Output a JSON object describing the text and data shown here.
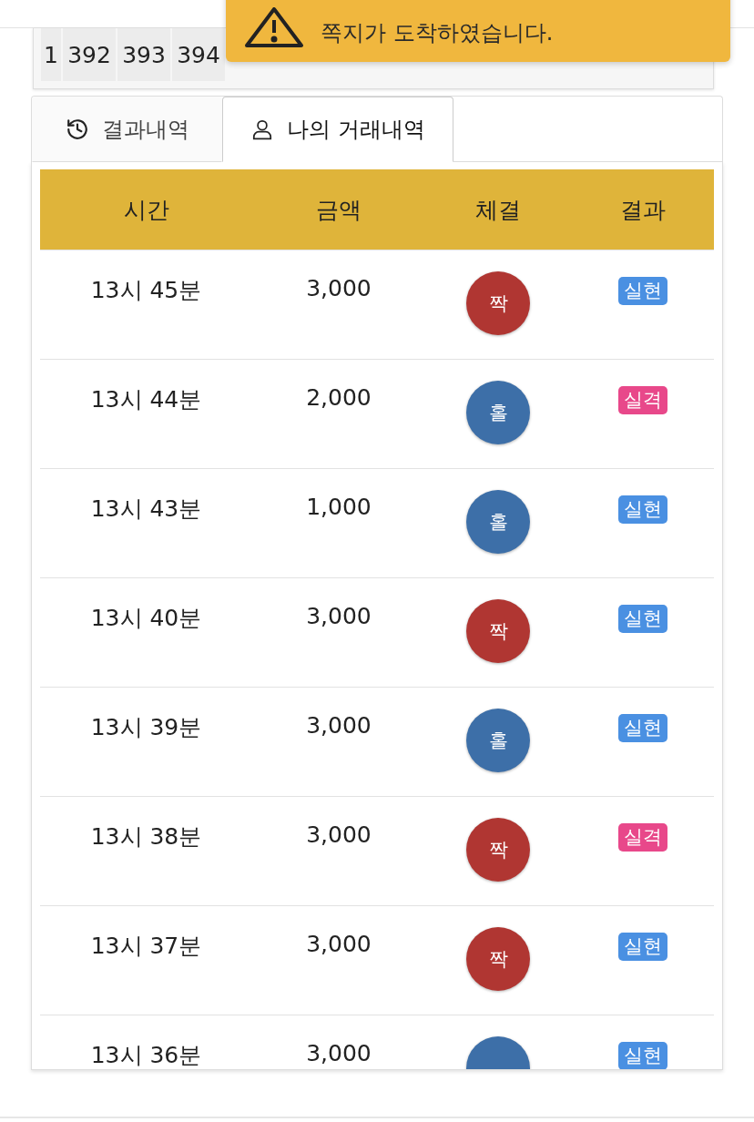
{
  "number_strip": [
    "1",
    "392",
    "393",
    "394"
  ],
  "toast": {
    "message": "쪽지가 도착하였습니다."
  },
  "tabs": [
    {
      "label": "결과내역",
      "selected": false
    },
    {
      "label": "나의 거래내역",
      "selected": true
    }
  ],
  "table": {
    "columns": [
      "시간",
      "금액",
      "체결",
      "결과"
    ],
    "rows": [
      {
        "time": "13시 45분",
        "amount": "3,000",
        "bet": {
          "label": "짝",
          "color": "#b03632"
        },
        "result": {
          "label": "실현",
          "color": "#4a90e2"
        }
      },
      {
        "time": "13시 44분",
        "amount": "2,000",
        "bet": {
          "label": "홀",
          "color": "#3d6fa8"
        },
        "result": {
          "label": "실격",
          "color": "#e8488a"
        }
      },
      {
        "time": "13시 43분",
        "amount": "1,000",
        "bet": {
          "label": "홀",
          "color": "#3d6fa8"
        },
        "result": {
          "label": "실현",
          "color": "#4a90e2"
        }
      },
      {
        "time": "13시 40분",
        "amount": "3,000",
        "bet": {
          "label": "짝",
          "color": "#b03632"
        },
        "result": {
          "label": "실현",
          "color": "#4a90e2"
        }
      },
      {
        "time": "13시 39분",
        "amount": "3,000",
        "bet": {
          "label": "홀",
          "color": "#3d6fa8"
        },
        "result": {
          "label": "실현",
          "color": "#4a90e2"
        }
      },
      {
        "time": "13시 38분",
        "amount": "3,000",
        "bet": {
          "label": "짝",
          "color": "#b03632"
        },
        "result": {
          "label": "실격",
          "color": "#e8488a"
        }
      },
      {
        "time": "13시 37분",
        "amount": "3,000",
        "bet": {
          "label": "짝",
          "color": "#b03632"
        },
        "result": {
          "label": "실현",
          "color": "#4a90e2"
        }
      },
      {
        "time": "13시 36분",
        "amount": "3,000",
        "bet": {
          "color": "#3d6fa8"
        },
        "result": {
          "label": "실현",
          "color": "#4a90e2"
        }
      }
    ]
  }
}
